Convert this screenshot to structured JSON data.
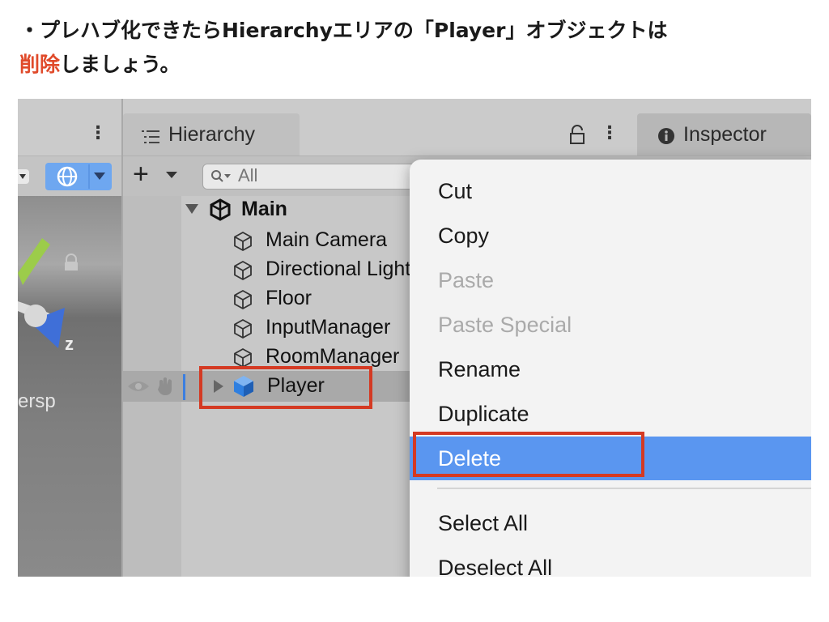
{
  "caption": {
    "line1": "・プレハブ化できたらHierarchyエリアの「Player」オブジェクトは",
    "line2_highlight": "削除",
    "line2_rest": "しましょう。"
  },
  "scene": {
    "axis_label": "z",
    "persp_label": "ersp"
  },
  "hierarchy": {
    "tab_label": "Hierarchy",
    "search_placeholder": "All",
    "add_label": "+",
    "scene_name": "Main",
    "items": [
      {
        "label": "Main Camera"
      },
      {
        "label": "Directional Light"
      },
      {
        "label": "Floor"
      },
      {
        "label": "InputManager"
      },
      {
        "label": "RoomManager"
      }
    ],
    "selected_item": "Player"
  },
  "inspector": {
    "tab_label": "Inspector"
  },
  "context_menu": {
    "items": [
      {
        "label": "Cut",
        "state": "enabled"
      },
      {
        "label": "Copy",
        "state": "enabled"
      },
      {
        "label": "Paste",
        "state": "disabled"
      },
      {
        "label": "Paste Special",
        "state": "disabled"
      },
      {
        "label": "Rename",
        "state": "enabled"
      },
      {
        "label": "Duplicate",
        "state": "enabled"
      },
      {
        "label": "Delete",
        "state": "highlighted"
      },
      {
        "label": "Select All",
        "state": "enabled"
      },
      {
        "label": "Deselect All",
        "state": "enabled"
      }
    ]
  },
  "colors": {
    "accent_red": "#e04a2a",
    "highlight_box": "#d43a23",
    "menu_selection": "#5a96f0",
    "cube_icon_blue": "#2f7fe0"
  }
}
